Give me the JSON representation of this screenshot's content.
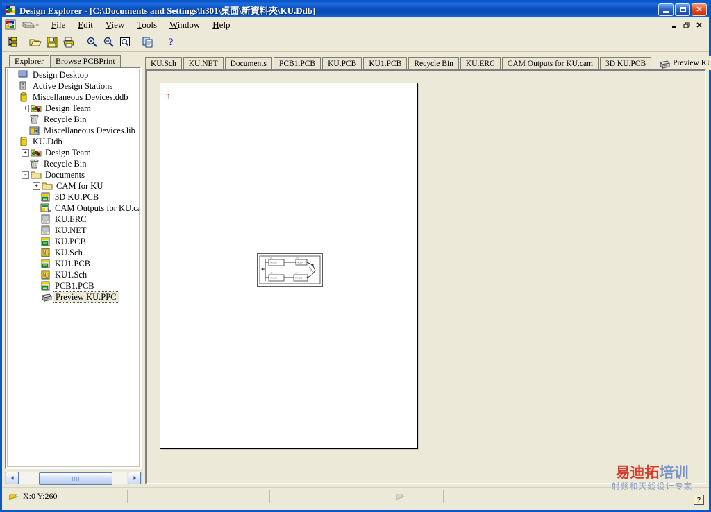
{
  "window": {
    "title": "Design Explorer - [C:\\Documents and Settings\\h301\\桌面\\新資料夾\\KU.Ddb]",
    "icon": "design-explorer-icon",
    "controls": {
      "minimize": "_",
      "maximize": "□",
      "close": "×"
    }
  },
  "menu": {
    "items": [
      {
        "label": "File",
        "accel": "F"
      },
      {
        "label": "Edit",
        "accel": "E"
      },
      {
        "label": "View",
        "accel": "V"
      },
      {
        "label": "Tools",
        "accel": "T"
      },
      {
        "label": "Window",
        "accel": "W"
      },
      {
        "label": "Help",
        "accel": "H"
      }
    ],
    "mdi_controls": {
      "minimize": "_",
      "restore": "❐",
      "close": "✕"
    }
  },
  "toolbar": {
    "buttons": [
      {
        "name": "new-design-icon",
        "tip": "New"
      },
      {
        "name": "open-folder-icon",
        "tip": "Open"
      },
      {
        "name": "save-icon",
        "tip": "Save"
      },
      {
        "name": "print-icon",
        "tip": "Print"
      },
      {
        "name": "zoom-in-icon",
        "tip": "Zoom In"
      },
      {
        "name": "zoom-out-icon",
        "tip": "Zoom Out"
      },
      {
        "name": "zoom-area-icon",
        "tip": "Zoom Area"
      },
      {
        "name": "copy-icon",
        "tip": "Copy"
      },
      {
        "name": "help-icon",
        "tip": "Help"
      }
    ]
  },
  "left_panel": {
    "tabs": [
      {
        "label": "Explorer",
        "active": true
      },
      {
        "label": "Browse PCBPrint",
        "active": false
      }
    ],
    "tree": [
      {
        "label": "Design Desktop",
        "indent": 0,
        "icon": "desktop-icon",
        "toggle": "",
        "selected": false
      },
      {
        "label": "Active Design Stations",
        "indent": 0,
        "icon": "station-icon",
        "toggle": "",
        "selected": false
      },
      {
        "label": "Miscellaneous Devices.ddb",
        "indent": 0,
        "icon": "database-icon",
        "toggle": "",
        "selected": false
      },
      {
        "label": "Design Team",
        "indent": 1,
        "icon": "folder-team-icon",
        "toggle": "+",
        "selected": false
      },
      {
        "label": "Recycle Bin",
        "indent": 1,
        "icon": "recycle-bin-icon",
        "toggle": "",
        "selected": false
      },
      {
        "label": "Miscellaneous Devices.lib",
        "indent": 1,
        "icon": "library-icon",
        "toggle": "",
        "selected": false
      },
      {
        "label": "KU.Ddb",
        "indent": 0,
        "icon": "database-icon",
        "toggle": "",
        "selected": false
      },
      {
        "label": "Design Team",
        "indent": 1,
        "icon": "folder-team-icon",
        "toggle": "+",
        "selected": false
      },
      {
        "label": "Recycle Bin",
        "indent": 1,
        "icon": "recycle-bin-icon",
        "toggle": "",
        "selected": false
      },
      {
        "label": "Documents",
        "indent": 1,
        "icon": "folder-icon",
        "toggle": "-",
        "selected": false
      },
      {
        "label": "CAM for KU",
        "indent": 2,
        "icon": "folder-icon",
        "toggle": "+",
        "selected": false
      },
      {
        "label": "3D KU.PCB",
        "indent": 2,
        "icon": "pcb-doc-icon",
        "toggle": "",
        "selected": false
      },
      {
        "label": "CAM Outputs for KU.cam",
        "indent": 2,
        "icon": "cam-doc-icon",
        "toggle": "",
        "selected": false
      },
      {
        "label": "KU.ERC",
        "indent": 2,
        "icon": "text-doc-icon",
        "toggle": "",
        "selected": false
      },
      {
        "label": "KU.NET",
        "indent": 2,
        "icon": "text-doc-icon",
        "toggle": "",
        "selected": false
      },
      {
        "label": "KU.PCB",
        "indent": 2,
        "icon": "pcb-doc-icon",
        "toggle": "",
        "selected": false
      },
      {
        "label": "KU.Sch",
        "indent": 2,
        "icon": "sch-doc-icon",
        "toggle": "",
        "selected": false
      },
      {
        "label": "KU1.PCB",
        "indent": 2,
        "icon": "pcb-doc-icon",
        "toggle": "",
        "selected": false
      },
      {
        "label": "KU1.Sch",
        "indent": 2,
        "icon": "sch-doc-icon",
        "toggle": "",
        "selected": false
      },
      {
        "label": "PCB1.PCB",
        "indent": 2,
        "icon": "pcb-doc-icon",
        "toggle": "",
        "selected": false
      },
      {
        "label": "Preview KU.PPC",
        "indent": 2,
        "icon": "pcbprint-doc-icon",
        "toggle": "",
        "selected": true
      }
    ],
    "scrollbar": {
      "left_arrow": "◄",
      "right_arrow": "►"
    }
  },
  "document_tabs": {
    "tabs": [
      {
        "label": "KU.Sch",
        "active": false,
        "icon": ""
      },
      {
        "label": "KU.NET",
        "active": false,
        "icon": ""
      },
      {
        "label": "Documents",
        "active": false,
        "icon": ""
      },
      {
        "label": "PCB1.PCB",
        "active": false,
        "icon": ""
      },
      {
        "label": "KU.PCB",
        "active": false,
        "icon": ""
      },
      {
        "label": "KU1.PCB",
        "active": false,
        "icon": ""
      },
      {
        "label": "Recycle Bin",
        "active": false,
        "icon": ""
      },
      {
        "label": "KU.ERC",
        "active": false,
        "icon": ""
      },
      {
        "label": "CAM Outputs for KU.cam",
        "active": false,
        "icon": ""
      },
      {
        "label": "3D KU.PCB",
        "active": false,
        "icon": ""
      },
      {
        "label": "Preview KU.PPC",
        "active": true,
        "icon": "pcbprint-doc-icon"
      }
    ],
    "scroll_left": "◄",
    "scroll_right": "►"
  },
  "preview": {
    "page_number": "1",
    "drawing": "pcb-layout-preview"
  },
  "status_bar": {
    "coordinates": "X:0 Y:260",
    "left_icon": "flag-icon",
    "mid_icon": "flag-icon-grey",
    "help_badge": "?"
  },
  "watermark": {
    "line1_red": "易迪拓",
    "line1_blue": "培训",
    "line2": "射频和天线设计专家"
  },
  "colors": {
    "title_bar_blue": "#0a52c0",
    "window_face": "#ece9d8",
    "window_border": "#0a58c8",
    "selection": "#316ac5",
    "page_white": "#ffffff",
    "page_number_red": "#d00000",
    "watermark_red": "#d93a2a",
    "watermark_blue": "#7a93c8"
  }
}
